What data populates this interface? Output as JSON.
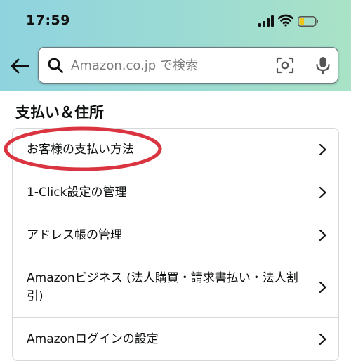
{
  "status_bar": {
    "time": "17:59"
  },
  "search": {
    "placeholder": "Amazon.co.jp で検索",
    "value": ""
  },
  "section": {
    "title": "支払い＆住所"
  },
  "menu_items": [
    {
      "label": "お客様の支払い方法"
    },
    {
      "label": "1-Click設定の管理"
    },
    {
      "label": "アドレス帳の管理"
    },
    {
      "label": "Amazonビジネス (法人購買・請求書払い・法人割引)"
    },
    {
      "label": "Amazonログインの設定"
    }
  ],
  "colors": {
    "header_gradient_start": "#8fd3df",
    "header_gradient_end": "#a9e2c6",
    "highlight": "#d9343f",
    "battery_fill": "#f0c419"
  },
  "icons": {
    "back": "left-arrow-icon",
    "search": "magnifier-icon",
    "camera": "camera-scan-icon",
    "mic": "microphone-icon",
    "chevron": "chevron-right-icon"
  }
}
